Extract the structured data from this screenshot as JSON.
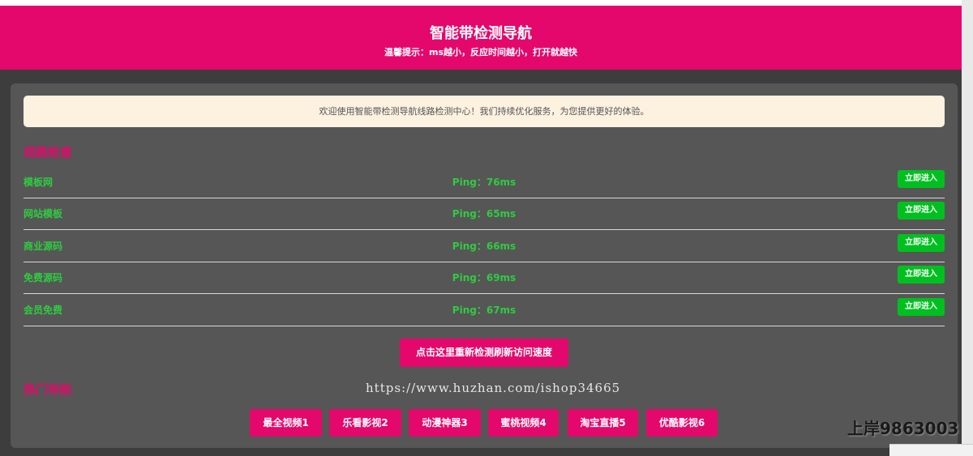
{
  "header": {
    "title": "智能带检测导航",
    "subtitle": "温馨提示：ms越小，反应时间越小，打开就越快"
  },
  "notice": "欢迎使用智能带检测导航线路检测中心！我们持续优化服务，为您提供更好的体验。",
  "line_check": {
    "title": "线路检查",
    "rows": [
      {
        "name": "模板网",
        "ping": "Ping：76ms",
        "button": "立即进入"
      },
      {
        "name": "网站模板",
        "ping": "Ping：65ms",
        "button": "立即进入"
      },
      {
        "name": "商业源码",
        "ping": "Ping：66ms",
        "button": "立即进入"
      },
      {
        "name": "免费源码",
        "ping": "Ping：69ms",
        "button": "立即进入"
      },
      {
        "name": "会员免费",
        "ping": "Ping：67ms",
        "button": "立即进入"
      }
    ]
  },
  "refresh_button": "点击这里重新检测刷新访问速度",
  "hot_nav": {
    "title": "热门导航",
    "items": [
      "最全视频1",
      "乐看影视2",
      "动漫神器3",
      "蜜桃视频4",
      "淘宝直播5",
      "优酷影视6"
    ]
  },
  "watermark": "https://www.huzhan.com/ishop34665",
  "corner_tag": "上岸9863003",
  "colors": {
    "accent": "#e4086c",
    "ok": "#2ecc40",
    "button_green": "#00c020",
    "panel": "#565656"
  }
}
